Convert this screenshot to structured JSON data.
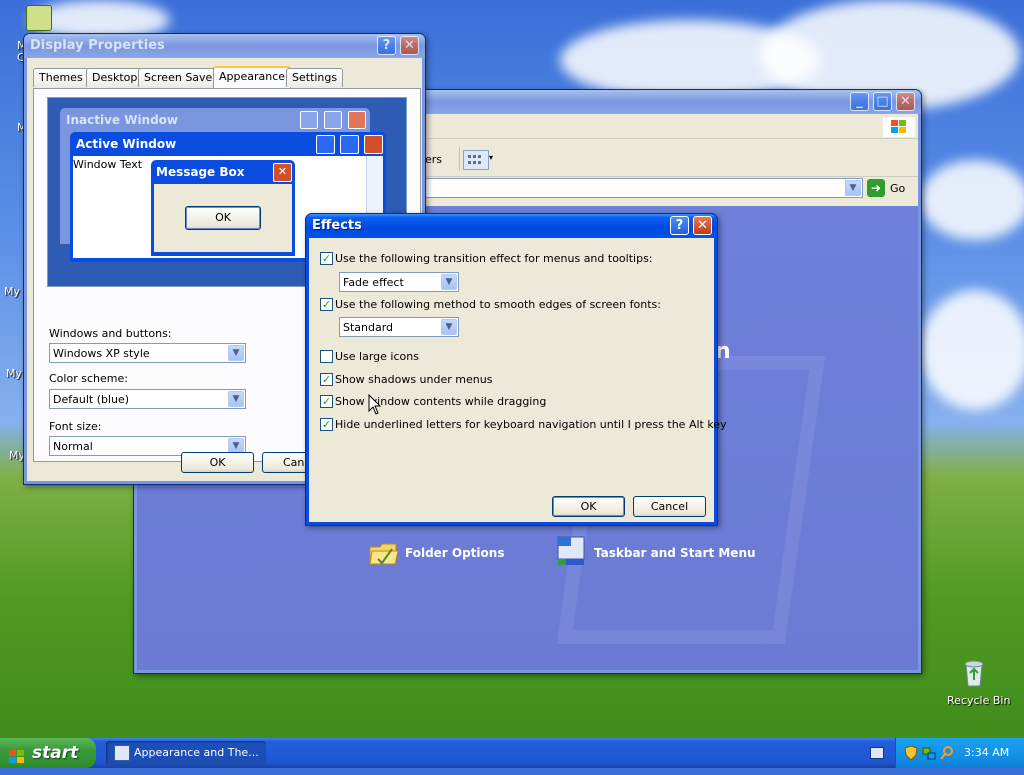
{
  "desktop": {
    "recycle_bin_label": "Recycle Bin",
    "left_icon_fragments": [
      "M\nC",
      "M",
      "My",
      "My",
      "My"
    ]
  },
  "control_panel": {
    "title": "",
    "toolbar_fragment": "ers",
    "go_label": "Go",
    "letter_fragment": "n",
    "tasks": [
      {
        "icon": "folder-icon",
        "label": "Folder Options"
      },
      {
        "icon": "taskbar-icon",
        "label": "Taskbar and Start Menu"
      }
    ]
  },
  "display_properties": {
    "title": "Display Properties",
    "tabs": [
      "Themes",
      "Desktop",
      "Screen Saver",
      "Appearance",
      "Settings"
    ],
    "active_tab": "Appearance",
    "preview": {
      "inactive_title": "Inactive Window",
      "active_title": "Active Window",
      "window_text": "Window Text",
      "message_title": "Message Box",
      "message_ok": "OK"
    },
    "windows_buttons_label": "Windows and buttons:",
    "windows_buttons_value": "Windows XP style",
    "color_scheme_label": "Color scheme:",
    "color_scheme_value": "Default (blue)",
    "font_size_label": "Font size:",
    "font_size_value": "Normal",
    "ok_label": "OK",
    "cancel_label": "Canc"
  },
  "effects": {
    "title": "Effects",
    "options": [
      {
        "label": "Use the following transition effect for menus and tooltips:",
        "checked": true
      },
      {
        "label": "Use the following method to smooth edges of screen fonts:",
        "checked": true
      },
      {
        "label": "Use large icons",
        "checked": false
      },
      {
        "label": "Show shadows under menus",
        "checked": true
      },
      {
        "label": "Show window contents while dragging",
        "checked": true
      },
      {
        "label": "Hide underlined letters for keyboard navigation until I press the Alt key",
        "checked": true
      }
    ],
    "transition_value": "Fade effect",
    "smoothing_value": "Standard",
    "ok_label": "OK",
    "cancel_label": "Cancel"
  },
  "taskbar": {
    "start_label": "start",
    "task_button_label": "Appearance and The...",
    "clock": "3:34 AM"
  },
  "colors": {
    "xp_blue": "#0a4ce0",
    "dialog_face": "#ece9d8",
    "cp_content": "#6d7fd8",
    "preview_desktop": "#2e5bb3"
  }
}
